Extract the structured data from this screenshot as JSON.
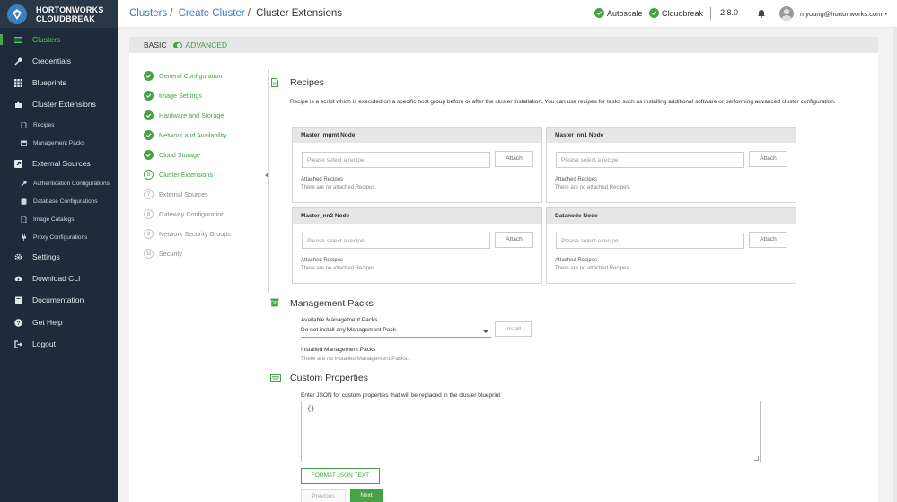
{
  "brand": {
    "line1": "HORTONWORKS",
    "line2": "CLOUDBREAK"
  },
  "sidebar": {
    "items": [
      {
        "label": "Clusters",
        "icon": "list-icon",
        "active": true
      },
      {
        "label": "Credentials",
        "icon": "key-icon"
      },
      {
        "label": "Blueprints",
        "icon": "grid-icon"
      },
      {
        "label": "Cluster Extensions",
        "icon": "puzzle-icon"
      },
      {
        "label": "External Sources",
        "icon": "external-icon"
      },
      {
        "label": "Settings",
        "icon": "gear-icon"
      },
      {
        "label": "Download CLI",
        "icon": "cloud-download-icon"
      },
      {
        "label": "Documentation",
        "icon": "book-icon"
      },
      {
        "label": "Get Help",
        "icon": "question-icon"
      },
      {
        "label": "Logout",
        "icon": "logout-icon"
      }
    ],
    "extensions_sub": [
      {
        "label": "Recipes",
        "icon": "document-icon"
      },
      {
        "label": "Management Packs",
        "icon": "archive-icon"
      }
    ],
    "external_sub": [
      {
        "label": "Authentication Configurations",
        "icon": "key-icon"
      },
      {
        "label": "Database Configurations",
        "icon": "database-icon"
      },
      {
        "label": "Image Catalogs",
        "icon": "document-icon"
      },
      {
        "label": "Proxy Configurations",
        "icon": "plug-icon"
      }
    ]
  },
  "header": {
    "crumbs": [
      "Clusters",
      "Create Cluster",
      "Cluster Extensions"
    ],
    "separator": "/",
    "autoscale": "Autoscale",
    "cloudbreak": "Cloudbreak",
    "version": "2.8.0",
    "user": "myoung@hortonworks.com",
    "user_caret": "▾"
  },
  "mode": {
    "basic": "BASIC",
    "advanced": "ADVANCED"
  },
  "steps": [
    {
      "num": "1",
      "label": "General Configuration",
      "state": "done"
    },
    {
      "num": "2",
      "label": "Image Settings",
      "state": "done"
    },
    {
      "num": "3",
      "label": "Hardware and Storage",
      "state": "done"
    },
    {
      "num": "4",
      "label": "Network and Availability",
      "state": "done"
    },
    {
      "num": "5",
      "label": "Cloud Storage",
      "state": "done"
    },
    {
      "num": "6",
      "label": "Cluster Extensions",
      "state": "current"
    },
    {
      "num": "7",
      "label": "External Sources",
      "state": "todo"
    },
    {
      "num": "8",
      "label": "Gateway Configuration",
      "state": "todo"
    },
    {
      "num": "9",
      "label": "Network Security Groups",
      "state": "todo"
    },
    {
      "num": "10",
      "label": "Security",
      "state": "todo"
    }
  ],
  "recipes": {
    "title": "Recipes",
    "description": "Recipe is a script which is executed on a specific host group before or after the cluster installation. You can use recipes for tasks such as installing additional software or performing advanced cluster configuration.",
    "nodes": [
      {
        "name": "Master_mgmt Node"
      },
      {
        "name": "Master_nn1 Node"
      },
      {
        "name": "Master_nn2 Node"
      },
      {
        "name": "Datanode Node"
      }
    ],
    "placeholder": "Please select a recipe",
    "attach": "Attach",
    "attached_label": "Attached Recipes",
    "none_label": "There are no attached Recipes."
  },
  "management_packs": {
    "title": "Management Packs",
    "available_label": "Available Management Packs",
    "selected": "Do not install any Management Pack",
    "install": "Install",
    "installed_label": "Installed Management Packs",
    "installed_none": "There are no installed Management Packs."
  },
  "custom_properties": {
    "title": "Custom Properties",
    "label": "Enter JSON for custom properties that will be replaced in the cluster blueprint",
    "value": "{}",
    "format_button": "FORMAT JSON TEXT"
  },
  "footer": {
    "previous": "Previous",
    "next": "Next"
  },
  "colors": {
    "accent": "#45a245",
    "sidebar": "#1f2b3a",
    "link": "#3b7bbf"
  }
}
